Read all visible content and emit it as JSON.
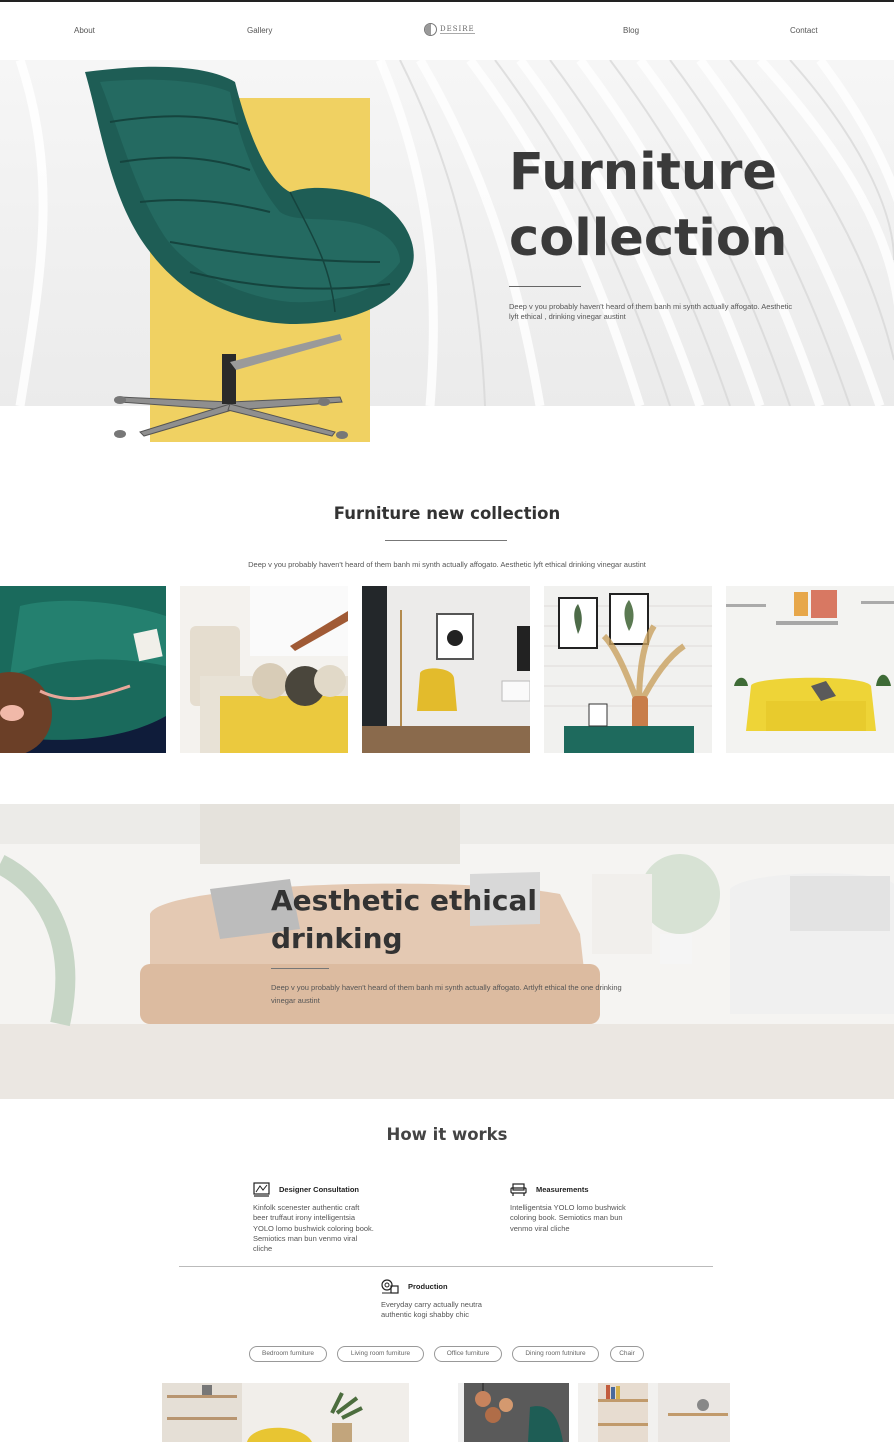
{
  "nav": {
    "about": "About",
    "gallery": "Gallery",
    "logo_text": "DESIRE",
    "blog": "Blog",
    "contact": "Contact"
  },
  "hero": {
    "title": "Furniture collection",
    "description": "Deep v you probably haven't heard of them banh mi synth actually affogato. Aesthetic lyft ethical , drinking vinegar austint",
    "colors": {
      "accent_yellow": "#f0d162",
      "chair_green": "#1e5d55"
    }
  },
  "collection": {
    "title": "Furniture new collection",
    "description": "Deep v you probably haven't heard of them banh mi synth actually affogato. Aesthetic lyft ethical drinking vinegar austint",
    "images": [
      "green-velvet-sofa-photo",
      "yellow-cushion-sofa-photo",
      "yellow-armchair-room-photo",
      "dried-flowers-vase-photo",
      "yellow-sofa-white-wall-photo"
    ]
  },
  "feature": {
    "title": "Aesthetic ethical drinking",
    "description": "Deep v you probably haven't heard of them banh mi synth actually affogato. Artlyft ethical the one drinking vinegar austint"
  },
  "how": {
    "title": "How it works",
    "steps": [
      {
        "icon": "blueprint-icon",
        "title": "Designer Consultation",
        "text": "Kinfolk scenester authentic craft beer truffaut irony intelligentsia YOLO lomo bushwick coloring book. Semiotics man bun venmo viral cliche"
      },
      {
        "icon": "sofa-icon",
        "title": "Measurements",
        "text": "Intelligentsia YOLO lomo bushwick coloring book. Semiotics man bun venmo viral cliche"
      },
      {
        "icon": "production-icon",
        "title": "Production",
        "text": "Everyday carry actually neutra authentic kogi shabby chic"
      }
    ]
  },
  "filters": [
    "Bedroom furniture",
    "Living room furniture",
    "Office furniture",
    "Dining room futniture",
    "Chair"
  ]
}
